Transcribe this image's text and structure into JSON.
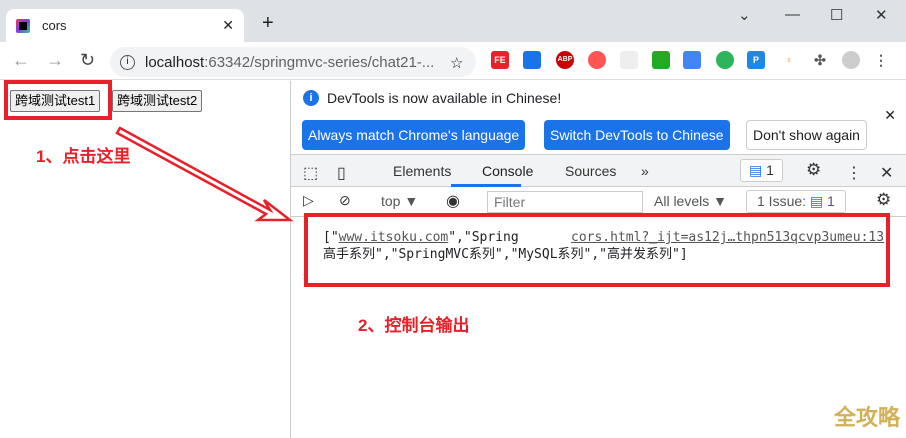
{
  "browser": {
    "tab_title": "cors",
    "url_host": "localhost",
    "url_rest": ":63342/springmvc-series/chat21-...",
    "extensions": [
      "FE",
      "ABP"
    ]
  },
  "page": {
    "buttons": [
      "跨域测试test1",
      "跨域测试test2"
    ]
  },
  "devtools": {
    "info_text": "DevTools is now available in Chinese!",
    "btn_match": "Always match Chrome's language",
    "btn_switch": "Switch DevTools to Chinese",
    "btn_dont": "Don't show again",
    "tabs": [
      "Elements",
      "Console",
      "Sources"
    ],
    "more_tabs": "»",
    "issues_count": "1",
    "context": "top ▼",
    "filter_placeholder": "Filter",
    "levels": "All levels ▼",
    "issue_label": "1 Issue:",
    "issue_num": "1",
    "console": {
      "line1_pre": "[\"",
      "link": "www.itsoku.com",
      "line1_post": "\",\"Spring",
      "source": "cors.html?_ijt=as12j…thpn513qcvp3umeu:13",
      "line2": "高手系列\",\"SpringMVC系列\",\"MySQL系列\",\"高并发系列\"]"
    }
  },
  "annotations": {
    "step1": "1、点击这里",
    "step2": "2、控制台输出",
    "color": "#e8202a"
  },
  "watermark": "全攻略"
}
